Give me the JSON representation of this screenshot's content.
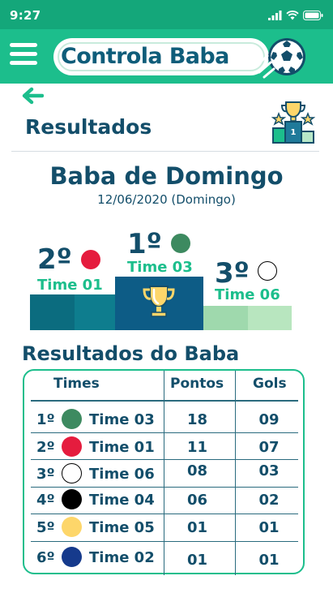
{
  "status": {
    "time": "9:27"
  },
  "app": {
    "logo_text": "Controla Baba"
  },
  "page": {
    "title": "Resultados"
  },
  "event": {
    "title": "Baba de Domingo",
    "date": "12/06/2020 (Domingo)"
  },
  "podium": {
    "first": {
      "place": "1º",
      "team": "Time 03",
      "color": "#3d8a60"
    },
    "second": {
      "place": "2º",
      "team": "Time 01",
      "color": "#e51c3e"
    },
    "third": {
      "place": "3º",
      "team": "Time 06",
      "color": "#ffffff"
    }
  },
  "results": {
    "title": "Resultados do Baba",
    "headers": {
      "teams": "Times",
      "points": "Pontos",
      "goals": "Gols"
    },
    "rows": [
      {
        "pos": "1º",
        "team": "Time 03",
        "color": "#3d8a60",
        "points": "18",
        "goals": "09"
      },
      {
        "pos": "2º",
        "team": "Time 01",
        "color": "#e51c3e",
        "points": "11",
        "goals": "07"
      },
      {
        "pos": "3º",
        "team": "Time 06",
        "color": "#ffffff",
        "points": "08",
        "goals": "03"
      },
      {
        "pos": "4º",
        "team": "Time 04",
        "color": "#000000",
        "points": "06",
        "goals": "02"
      },
      {
        "pos": "5º",
        "team": "Time 05",
        "color": "#fdd66a",
        "points": "01",
        "goals": "01"
      },
      {
        "pos": "6º",
        "team": "Time 02",
        "color": "#163a8c",
        "points": "01",
        "goals": "01"
      }
    ]
  },
  "colors": {
    "accent": "#1cbe8c",
    "status_bar": "#14a77a",
    "primary_text": "#134e6a"
  },
  "icons": {
    "menu": "hamburger-icon",
    "back": "arrow-left-icon",
    "podium": "podium-trophy-icon",
    "trophy": "trophy-icon",
    "ball": "soccer-ball-icon"
  }
}
